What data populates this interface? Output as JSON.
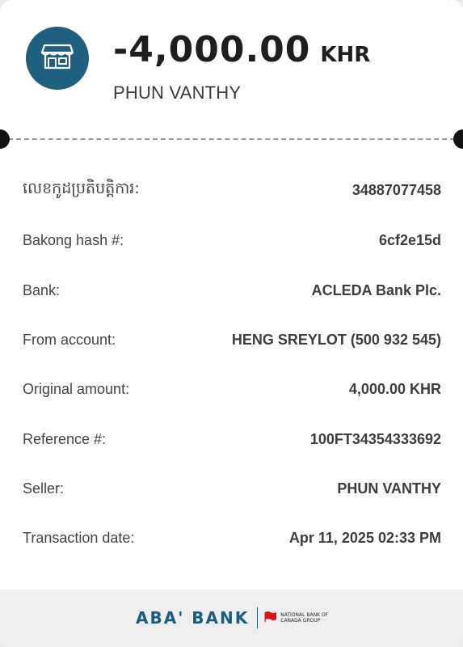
{
  "header": {
    "amount": "-4,000.00",
    "currency": "KHR",
    "payee": "PHUN VANTHY",
    "icon": "store-icon"
  },
  "details": [
    {
      "label": "លេខកូដប្រតិបត្តិការ:",
      "value": "34887077458"
    },
    {
      "label": "Bakong hash #:",
      "value": "6cf2e15d"
    },
    {
      "label": "Bank:",
      "value": "ACLEDA Bank Plc."
    },
    {
      "label": "From account:",
      "value": "HENG SREYLOT (500 932 545)"
    },
    {
      "label": "Original amount:",
      "value": "4,000.00 KHR"
    },
    {
      "label": "Reference #:",
      "value": "100FT34354333692"
    },
    {
      "label": "Seller:",
      "value": "PHUN VANTHY"
    },
    {
      "label": "Transaction date:",
      "value": "Apr 11, 2025 02:33 PM"
    }
  ],
  "footer": {
    "brand": "ABA' BANK",
    "partner": "NATIONAL BANK OF CANADA GROUP"
  },
  "colors": {
    "accent": "#1f5f80",
    "text": "#1e1e1e",
    "footer_bg": "#efefef"
  }
}
